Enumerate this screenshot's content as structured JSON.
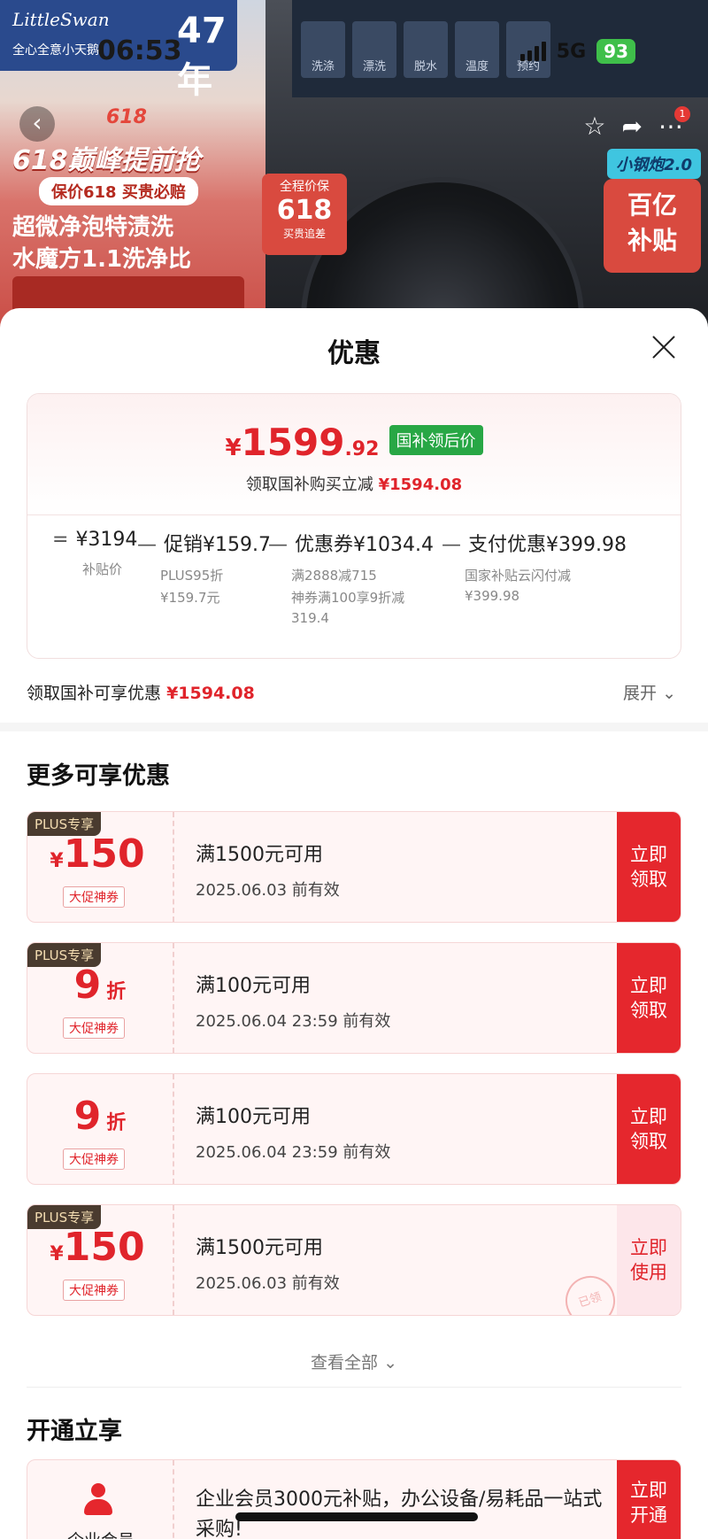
{
  "status": {
    "time": "06:53",
    "network": "5G",
    "battery": "93"
  },
  "banner": {
    "brand": "LittleSwan",
    "brand_slogan": "全心全意小天鹅",
    "brand_years": "47年",
    "badge_618": "618",
    "promo_title": "618巅峰提前抢",
    "promo_pill": "保价618 买贵必赔",
    "promo_line1": "超微净泡特渍洗",
    "promo_line2": "水魔方1.1洗净比",
    "price_protect_top": "全程价保",
    "price_protect_mid": "618",
    "price_protect_bot": "买贵追差",
    "wm_buttons": [
      "洗涤",
      "漂洗",
      "脱水",
      "温度",
      "预约"
    ],
    "series_tag": "小钢炮2.0",
    "subsidy_line1": "百亿",
    "subsidy_line2": "补贴",
    "cart_count": "1"
  },
  "sheet": {
    "title": "优惠",
    "price": {
      "currency": "¥",
      "integer": "1599",
      "decimal": ".92",
      "tag": "国补领后价"
    },
    "price_sub_prefix": "领取国补购买立减",
    "price_sub_amount": "¥1594.08",
    "formula": [
      {
        "op": "=",
        "value": "¥3194",
        "notes": [
          "补贴价"
        ]
      },
      {
        "op": "—",
        "value": "促销¥159.7",
        "notes": [
          "PLUS95折",
          "¥159.7元"
        ]
      },
      {
        "op": "—",
        "value": "优惠券¥1034.4",
        "notes": [
          "满2888减715",
          "神券满100享9折减",
          "319.4"
        ]
      },
      {
        "op": "—",
        "value": "支付优惠¥399.98",
        "notes": [
          "国家补贴云闪付减",
          "¥399.98"
        ]
      }
    ],
    "claim_prefix": "领取国补可享优惠",
    "claim_amount": "¥1594.08",
    "expand_label": "展开",
    "more_title": "更多可享优惠",
    "coupons": [
      {
        "plus": "PLUS专享",
        "symbol": "¥",
        "amount": "150",
        "unit": "",
        "tag": "大促神券",
        "condition": "满1500元可用",
        "expiry": "2025.06.03 前有效",
        "button": "立即\n领取"
      },
      {
        "plus": "PLUS专享",
        "symbol": "",
        "amount": "9",
        "unit": "折",
        "tag": "大促神券",
        "condition": "满100元可用",
        "expiry": "2025.06.04 23:59 前有效",
        "button": "立即\n领取"
      },
      {
        "plus": "",
        "symbol": "",
        "amount": "9",
        "unit": "折",
        "tag": "大促神券",
        "condition": "满100元可用",
        "expiry": "2025.06.04 23:59 前有效",
        "button": "立即\n领取"
      },
      {
        "plus": "PLUS专享",
        "symbol": "¥",
        "amount": "150",
        "unit": "",
        "tag": "大促神券",
        "condition": "满1500元可用",
        "expiry": "2025.06.03 前有效",
        "button": "立即\n使用",
        "stamp": "已领"
      }
    ],
    "view_all": "查看全部",
    "open_title": "开通立享",
    "biz": {
      "label": "企业会员",
      "text": "企业会员3000元补贴，办公设备/易耗品一站式采购!",
      "button": "立即\n开通"
    }
  },
  "colors": {
    "accent": "#e5272d",
    "green_tag": "#28a745"
  }
}
